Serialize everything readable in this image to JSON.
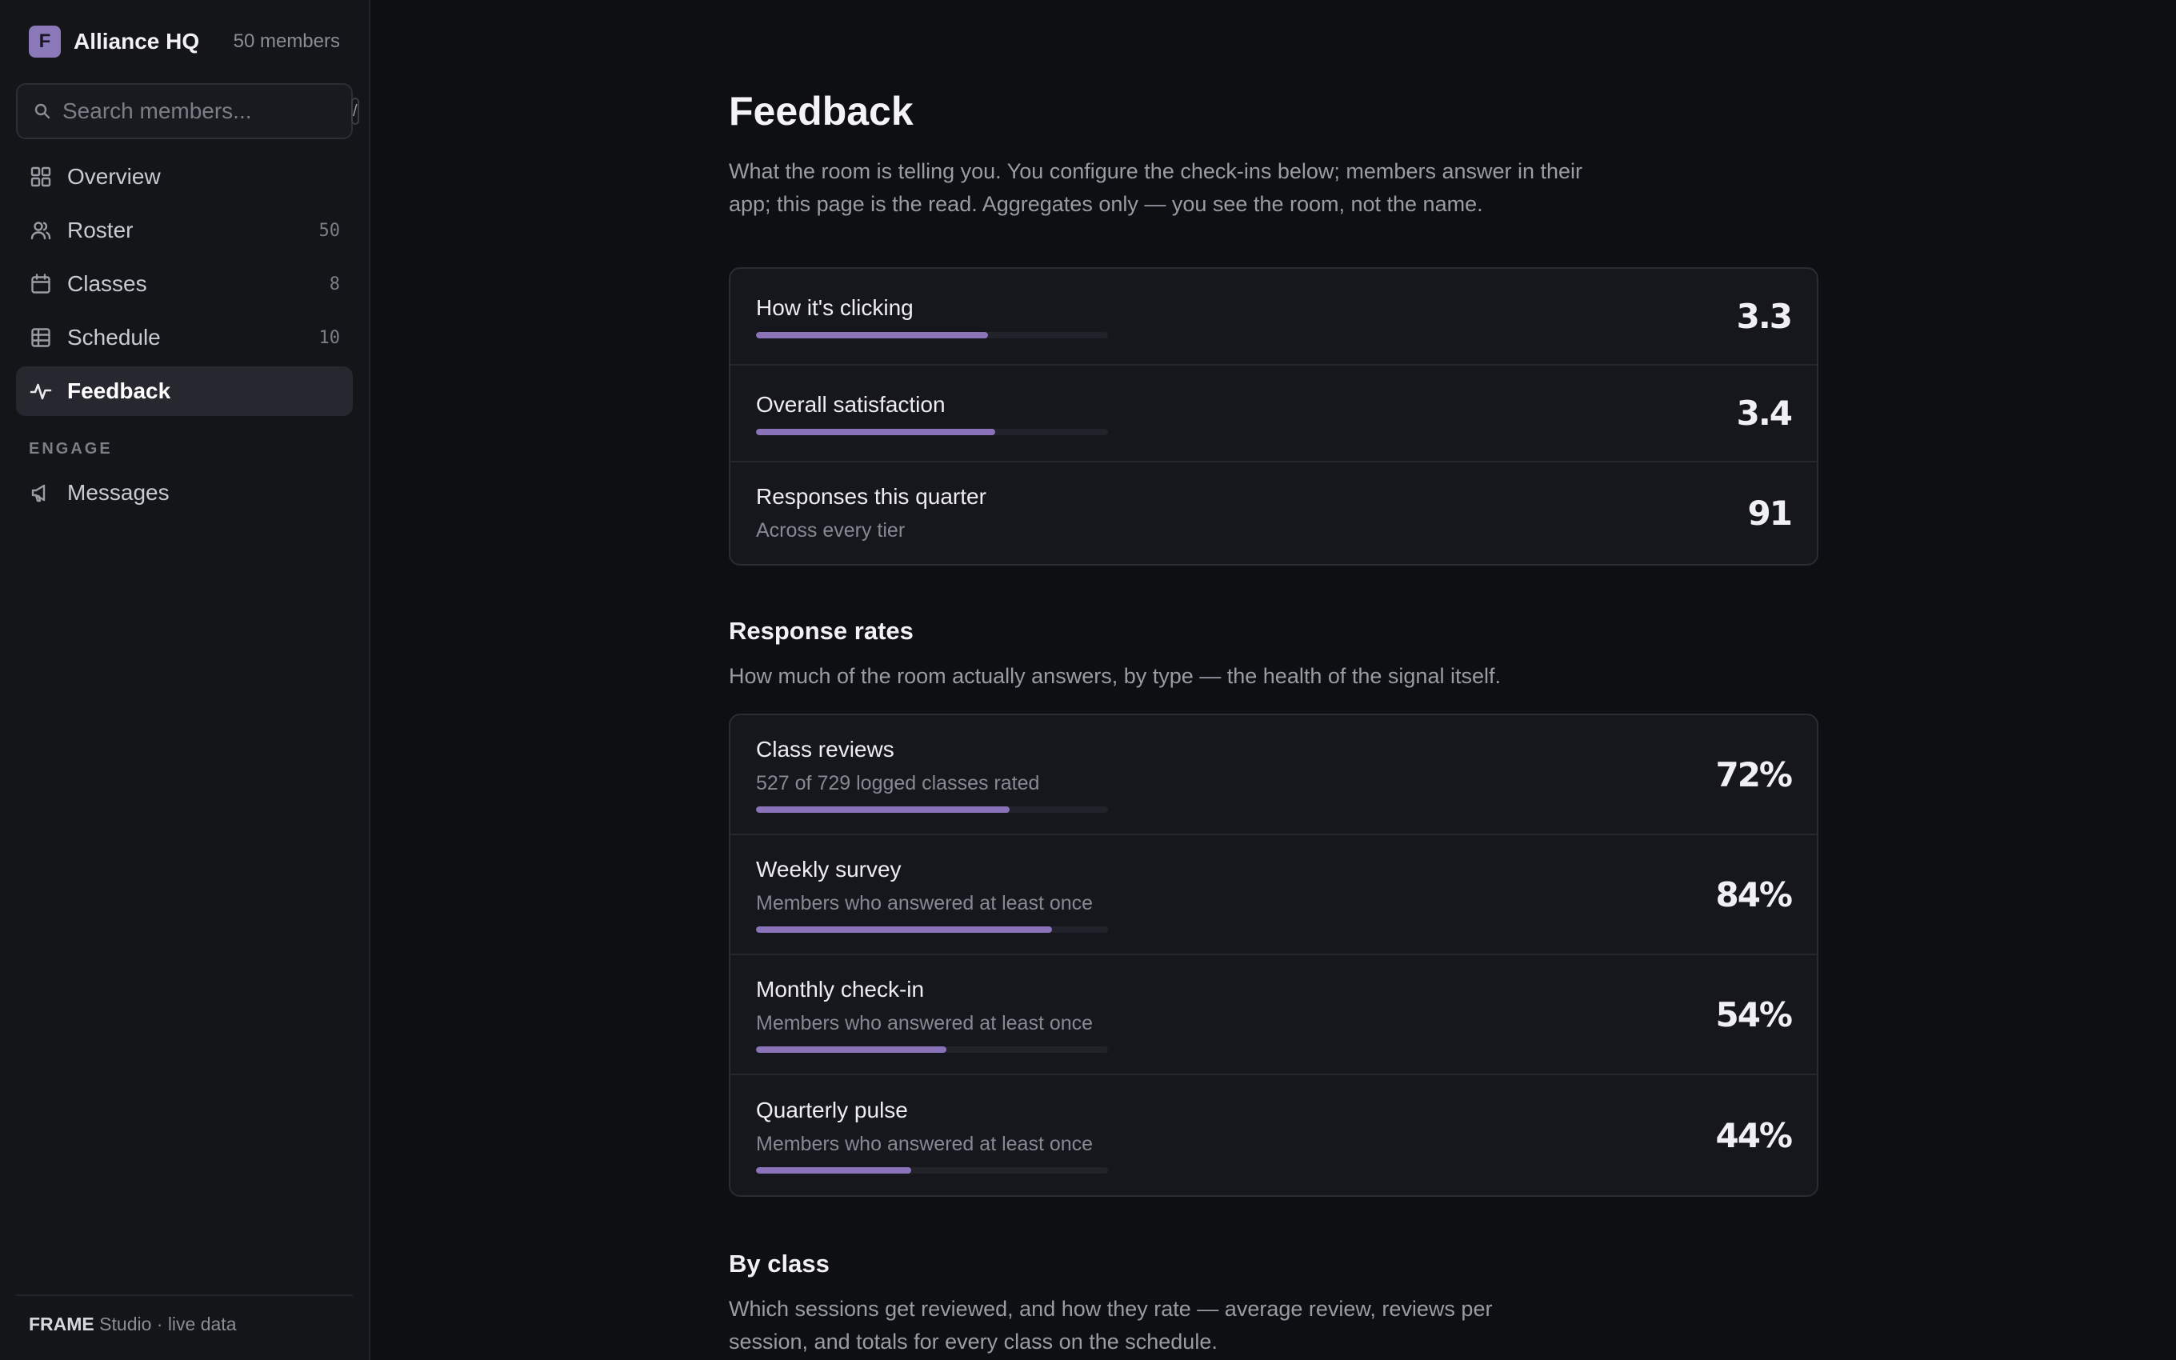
{
  "brand": {
    "logo_letter": "F",
    "name": "Alliance HQ",
    "member_count": "50 members"
  },
  "search": {
    "placeholder": "Search members...",
    "shortcut": "/"
  },
  "nav": {
    "items": [
      {
        "label": "Overview",
        "count": "",
        "icon": "grid-icon"
      },
      {
        "label": "Roster",
        "count": "50",
        "icon": "users-icon"
      },
      {
        "label": "Classes",
        "count": "8",
        "icon": "calendar-icon"
      },
      {
        "label": "Schedule",
        "count": "10",
        "icon": "table-icon"
      },
      {
        "label": "Feedback",
        "count": "",
        "icon": "pulse-icon",
        "active": true
      }
    ],
    "section_label": "ENGAGE",
    "engage_items": [
      {
        "label": "Messages",
        "icon": "megaphone-icon"
      }
    ]
  },
  "footer": {
    "brand": "FRAME",
    "text": " Studio · live data"
  },
  "page": {
    "title": "Feedback",
    "description": "What the room is telling you. You configure the check-ins below; members answer in their app; this page is the read. Aggregates only — you see the room, not the name."
  },
  "summary": [
    {
      "title": "How it's clicking",
      "value": "3.3",
      "fill": 0.66
    },
    {
      "title": "Overall satisfaction",
      "value": "3.4",
      "fill": 0.68
    },
    {
      "title": "Responses this quarter",
      "sub": "Across every tier",
      "value": "91"
    }
  ],
  "response_rates": {
    "title": "Response rates",
    "description": "How much of the room actually answers, by type — the health of the signal itself.",
    "rows": [
      {
        "title": "Class reviews",
        "sub": "527 of 729 logged classes rated",
        "value": "72%",
        "fill": 0.72
      },
      {
        "title": "Weekly survey",
        "sub": "Members who answered at least once",
        "value": "84%",
        "fill": 0.84
      },
      {
        "title": "Monthly check-in",
        "sub": "Members who answered at least once",
        "value": "54%",
        "fill": 0.54
      },
      {
        "title": "Quarterly pulse",
        "sub": "Members who answered at least once",
        "value": "44%",
        "fill": 0.44
      }
    ]
  },
  "by_class": {
    "title": "By class",
    "description": "Which sessions get reviewed, and how they rate — average review, reviews per session, and totals for every class on the schedule."
  },
  "colors": {
    "accent": "#8a73b8",
    "background": "#0e0f13",
    "sidebar": "#141519"
  }
}
